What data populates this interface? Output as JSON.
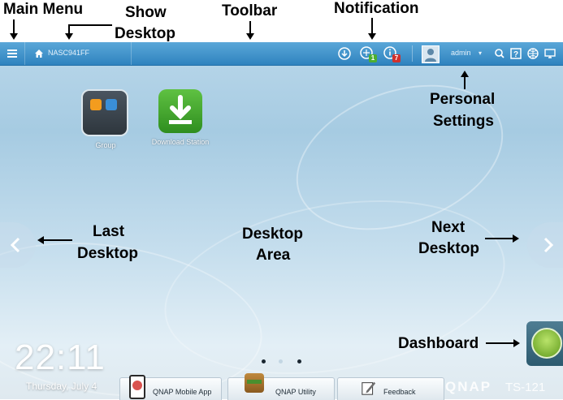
{
  "annotations": {
    "main_menu": "Main Menu",
    "show_desktop_1": "Show",
    "show_desktop_2": "Desktop",
    "toolbar": "Toolbar",
    "notification": "Notification",
    "personal_settings_1": "Personal",
    "personal_settings_2": "Settings",
    "last_desktop_1": "Last",
    "last_desktop_2": "Desktop",
    "desktop_area_1": "Desktop",
    "desktop_area_2": "Area",
    "next_desktop_1": "Next",
    "next_desktop_2": "Desktop",
    "dashboard": "Dashboard"
  },
  "toolbar": {
    "host_name": "NASC941FF",
    "notification_badge_green": "1",
    "notification_badge_red": "7",
    "username": "admin",
    "colors": {
      "bar_top": "#5aa7d8",
      "bar_bottom": "#2f83bf"
    }
  },
  "desktop": {
    "icons": [
      {
        "label": "Group",
        "icon": "group-folder-icon"
      },
      {
        "label": "Download Station",
        "icon": "download-station-icon"
      }
    ],
    "clock": "22:11",
    "date": "Thursday, July 4",
    "pages": {
      "count": 3,
      "current": 1
    }
  },
  "taskbar": {
    "items": [
      {
        "label": "QNAP Mobile App",
        "icon": "mobile-app-icon"
      },
      {
        "label": "QNAP Utility",
        "icon": "utility-icon"
      },
      {
        "label": "Feedback",
        "icon": "feedback-icon"
      }
    ],
    "brand": "QNAP",
    "model": "TS-121"
  }
}
